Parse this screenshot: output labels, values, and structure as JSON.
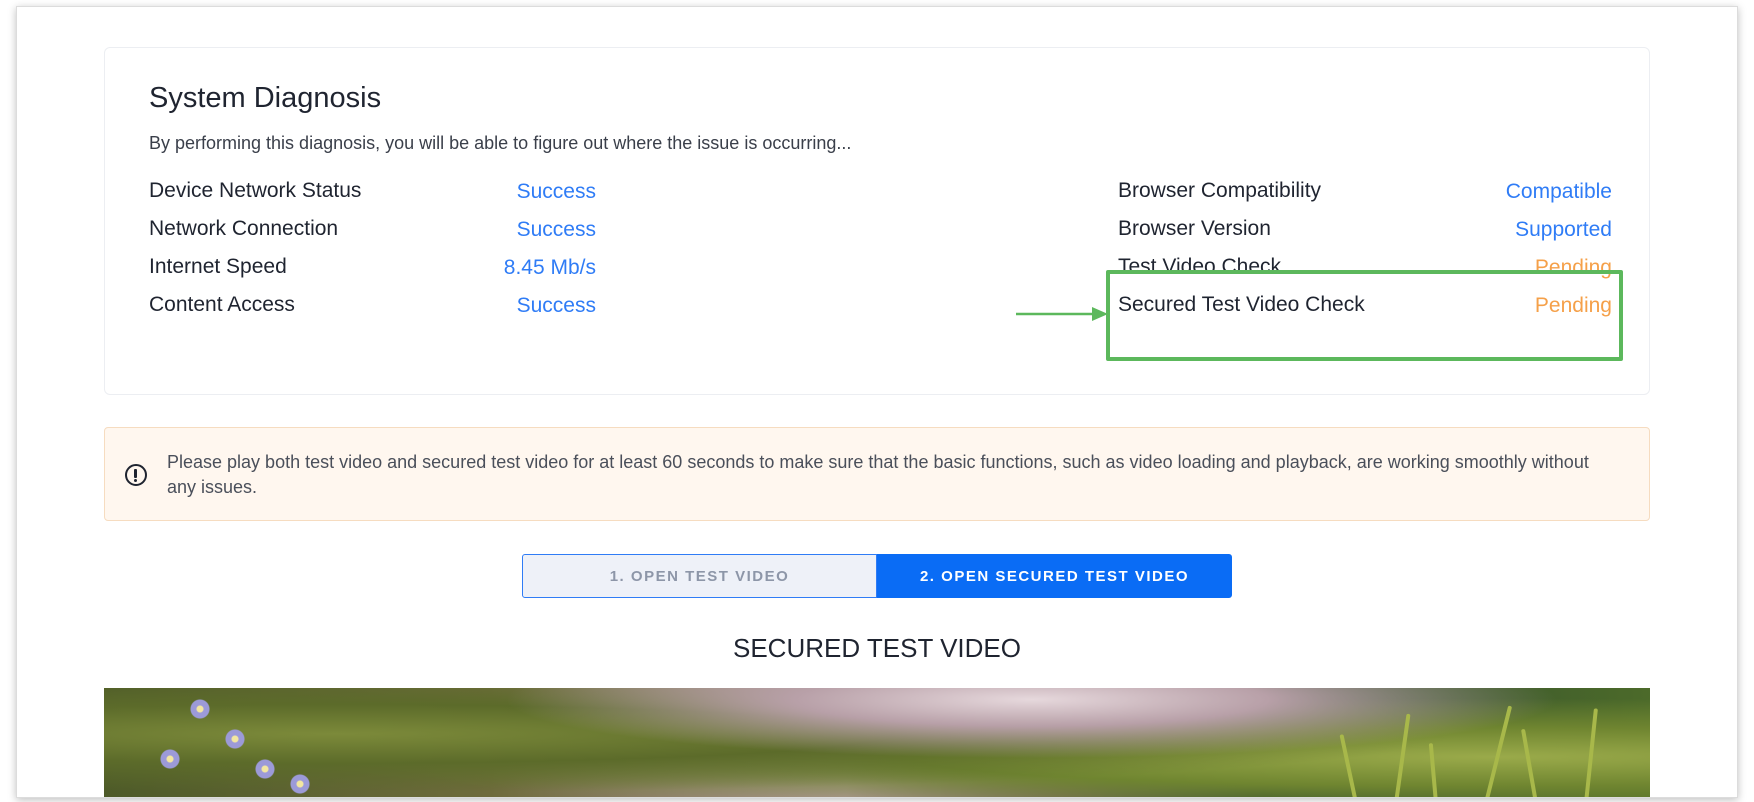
{
  "diagnosis": {
    "title": "System Diagnosis",
    "subtitle": "By performing this diagnosis, you will be able to figure out where the issue is occurring...",
    "left_checks": [
      {
        "label": "Device Network Status",
        "value": "Success"
      },
      {
        "label": "Network Connection",
        "value": "Success"
      },
      {
        "label": "Internet Speed",
        "value": "8.45 Mb/s"
      },
      {
        "label": "Content Access",
        "value": "Success"
      }
    ],
    "right_checks": [
      {
        "label": "Browser Compatibility",
        "value": "Compatible"
      },
      {
        "label": "Browser Version",
        "value": "Supported"
      },
      {
        "label": "Test Video Check",
        "value": "Pending"
      },
      {
        "label": "Secured Test Video Check",
        "value": "Pending"
      }
    ]
  },
  "alert": {
    "icon": "exclamation-circle-icon",
    "text": "Please play both test video and secured test video for at least 60 seconds to make sure that the basic functions, such as video loading and playback, are working smoothly without any issues."
  },
  "tabs": [
    {
      "label": "1. OPEN TEST VIDEO",
      "active": false
    },
    {
      "label": "2. OPEN SECURED TEST VIDEO",
      "active": true
    }
  ],
  "video": {
    "heading": "SECURED TEST VIDEO"
  },
  "colors": {
    "success": "#2f7cf6",
    "pending": "#f5a049",
    "highlight": "#5cb85c",
    "primary_button": "#0a6cf5"
  }
}
